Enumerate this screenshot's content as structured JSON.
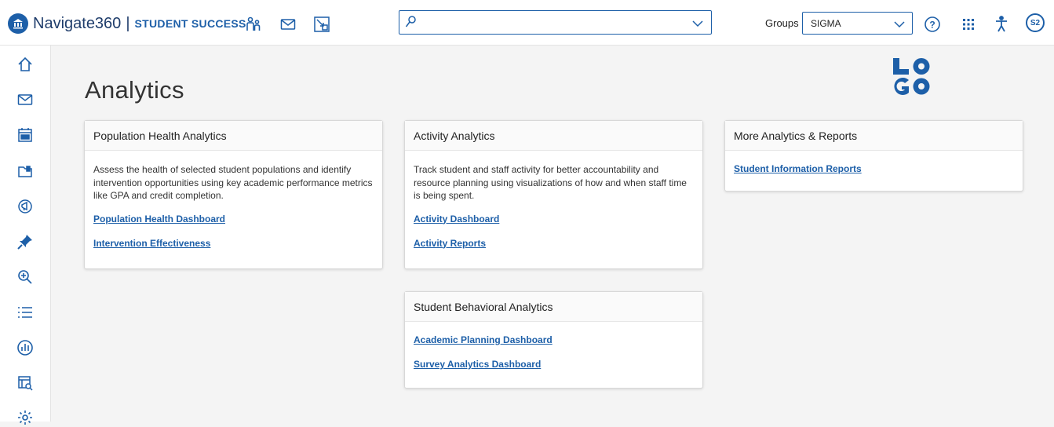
{
  "header": {
    "brand_name": "Navigate360",
    "brand_separator": "|",
    "brand_product": "STUDENT SUCCESS",
    "icons": [
      "people-icon",
      "mail-icon",
      "window-icon"
    ],
    "search": {
      "value": "",
      "placeholder": ""
    },
    "groups_label": "Groups",
    "groups_value": "SIGMA",
    "right_icons": [
      "help-icon",
      "apps-grid-icon",
      "accessibility-icon"
    ],
    "avatar_initials": "S2"
  },
  "sidebar": {
    "items": [
      {
        "name": "home"
      },
      {
        "name": "messages"
      },
      {
        "name": "calendar"
      },
      {
        "name": "folder"
      },
      {
        "name": "campaigns"
      },
      {
        "name": "pin"
      },
      {
        "name": "search"
      },
      {
        "name": "lists"
      },
      {
        "name": "analytics"
      },
      {
        "name": "reports"
      },
      {
        "name": "settings"
      }
    ]
  },
  "main": {
    "title": "Analytics",
    "logo_text": "LO GO",
    "cards": {
      "population": {
        "title": "Population Health Analytics",
        "description": "Assess the health of selected student populations and identify intervention opportunities using key academic performance metrics like GPA and credit completion.",
        "links": [
          "Population Health Dashboard",
          "Intervention Effectiveness"
        ]
      },
      "activity": {
        "title": "Activity Analytics",
        "description": "Track student and staff activity for better accountability and resource planning using visualizations of how and when staff time is being spent.",
        "links": [
          "Activity Dashboard",
          "Activity Reports"
        ]
      },
      "more": {
        "title": "More Analytics & Reports",
        "links": [
          "Student Information Reports"
        ]
      },
      "behavioral": {
        "title": "Student Behavioral Analytics",
        "links": [
          "Academic Planning Dashboard",
          "Survey Analytics Dashboard"
        ]
      }
    }
  },
  "colors": {
    "accent": "#1d5fa8",
    "brand_dark": "#1f3d6b",
    "background": "#f4f4f4"
  }
}
